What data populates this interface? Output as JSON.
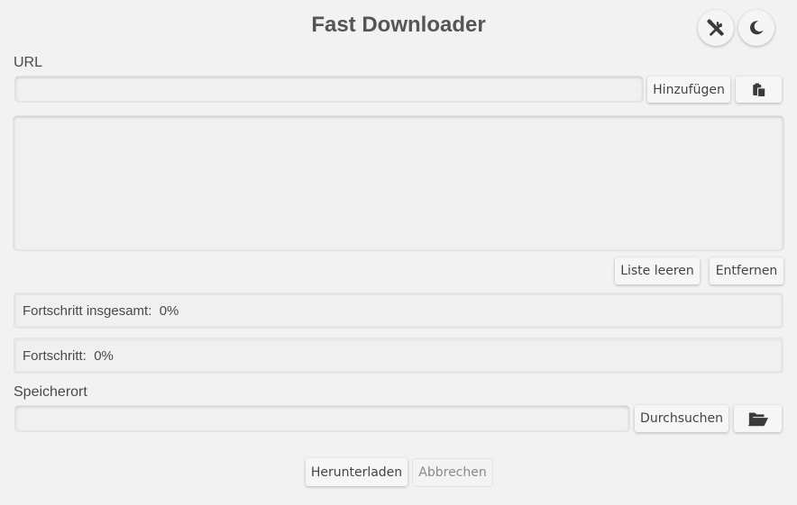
{
  "app": {
    "title": "Fast Downloader"
  },
  "header": {
    "settings_icon": "tools-icon",
    "theme_icon": "moon-icon"
  },
  "url_section": {
    "label": "URL",
    "input_value": "",
    "add_button": "Hinzufügen",
    "paste_icon": "clipboard-paste-icon"
  },
  "url_list": {
    "items": []
  },
  "list_actions": {
    "clear_button": "Liste leeren",
    "remove_button": "Entfernen"
  },
  "progress_total": {
    "label": "Fortschritt insgesamt:",
    "value": "0%",
    "fraction": 0
  },
  "progress_current": {
    "label": "Fortschritt:",
    "value": "0%",
    "fraction": 0
  },
  "storage": {
    "label": "Speicherort",
    "input_value": "",
    "browse_button": "Durchsuchen",
    "folder_icon": "folder-open-icon"
  },
  "footer": {
    "download_button": "Herunterladen",
    "cancel_button": "Abbrechen"
  },
  "colors": {
    "background": "#f2f2f2",
    "text": "#4a4a4a"
  }
}
